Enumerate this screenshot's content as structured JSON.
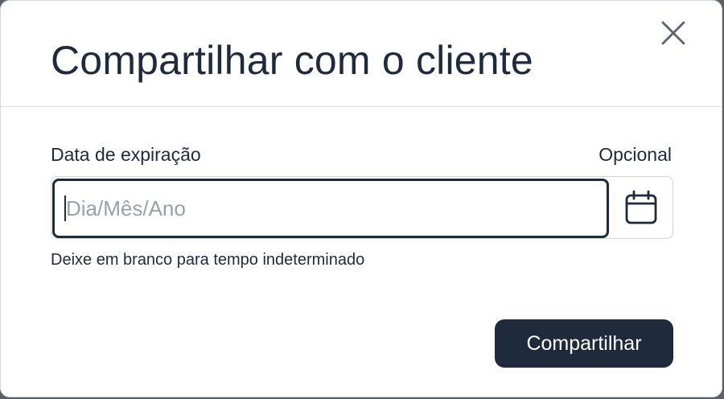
{
  "dialog": {
    "title": "Compartilhar com o cliente",
    "close_icon": "close-icon"
  },
  "expiration_field": {
    "label": "Data de expiração",
    "optional_label": "Opcional",
    "value": "",
    "placeholder": "Dia/Mês/Ano",
    "calendar_icon": "calendar-icon",
    "helper_text": "Deixe em branco para tempo indeterminado"
  },
  "actions": {
    "share_label": "Compartilhar"
  },
  "colors": {
    "primary": "#1f2a3c",
    "placeholder": "#9aa0aa",
    "border": "#d0d4da",
    "background": "#ffffff"
  }
}
